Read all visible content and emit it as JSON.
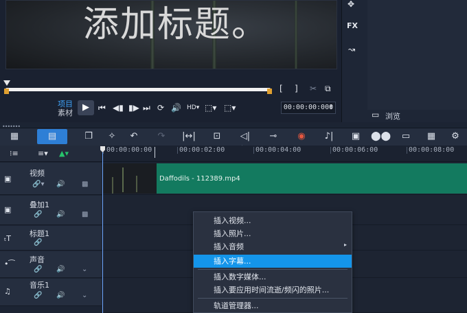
{
  "preview": {
    "overlay_title": "添加标题。",
    "mode_project": "项目",
    "mode_clip": "素材",
    "timecode": "00:00:00:000",
    "bracket_in": "[",
    "bracket_out": "]"
  },
  "right_panel": {
    "fx_label": "FX",
    "browse_label": "浏览"
  },
  "ruler": {
    "ticks": [
      "00:00:00:00",
      "00:00:02:00",
      "00:00:04:00",
      "00:00:06:00",
      "00:00:08:00"
    ]
  },
  "tracks": [
    {
      "name": "视频"
    },
    {
      "name": "叠加1"
    },
    {
      "name": "标题1"
    },
    {
      "name": "声音"
    },
    {
      "name": "音乐1"
    }
  ],
  "clip": {
    "label": "Daffodils - 112389.mp4",
    "color": "#137a5f"
  },
  "context_menu": {
    "items": [
      {
        "label": "插入视频..."
      },
      {
        "label": "插入照片..."
      },
      {
        "label": "插入音频",
        "submenu": true
      },
      {
        "label": "插入字幕...",
        "selected": true
      },
      {
        "label": "插入数字媒体..."
      },
      {
        "label": "插入要应用时间流逝/频闪的照片..."
      },
      {
        "label": "轨道管理器..."
      }
    ]
  },
  "colors": {
    "accent": "#1495ea",
    "timeline_button": "#2e7fd6",
    "mode_project": "#3fa2f7",
    "trim_marker": "#e0a030"
  }
}
